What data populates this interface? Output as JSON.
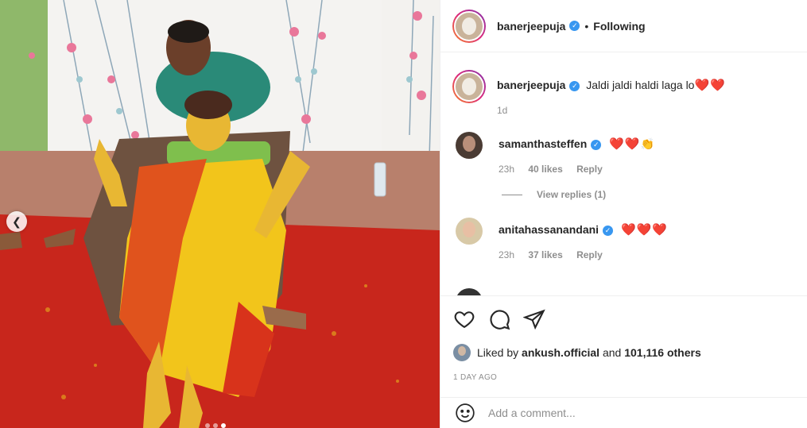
{
  "post": {
    "username": "banerjeepuja",
    "follow_separator": "•",
    "follow_status": "Following"
  },
  "caption": {
    "username": "banerjeepuja",
    "text": "Jaldi jaldi haldi laga lo",
    "emoji": "❤️❤️",
    "time": "1d"
  },
  "comments": [
    {
      "username": "samanthasteffen",
      "emoji": "❤️❤️",
      "emoji_extra": "👏",
      "time": "23h",
      "likes": "40 likes",
      "reply": "Reply",
      "view_replies": "View replies (1)"
    },
    {
      "username": "anitahassanandani",
      "emoji": "❤️❤️❤️",
      "time": "23h",
      "likes": "37 likes",
      "reply": "Reply"
    }
  ],
  "likes": {
    "prefix": "Liked by",
    "user": "ankush.official",
    "middle": "and",
    "count": "101,116 others"
  },
  "timestamp": "1 DAY AGO",
  "add_comment": {
    "placeholder": "Add a comment..."
  },
  "icons": {
    "like": "heart-icon",
    "comment": "comment-icon",
    "share": "share-icon",
    "emoji": "emoji-icon",
    "prev": "chevron-left-icon",
    "verified": "verified-badge-icon"
  },
  "colors": {
    "verified": "#3897f0",
    "heart_emoji": "#e0245e",
    "muted_text": "#8e8e8e"
  }
}
